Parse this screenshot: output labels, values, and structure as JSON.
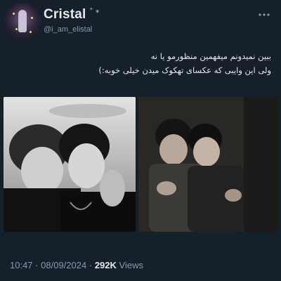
{
  "profile": {
    "display_name": "Cristal",
    "name_decoration": "⁺ ⁎",
    "handle": "@i_am_elistal",
    "avatar_icon": "avatar-photo"
  },
  "header": {
    "more_icon": "more-options-icon"
  },
  "tweet": {
    "lines": [
      "ببین نمیدونم میفهمین منظورمو یا نه",
      "ولی این وایبی که عکسای تهکوک میدن خیلی خوبه:)"
    ]
  },
  "media": {
    "photos": [
      {
        "icon": "photo-black-and-white-selfie"
      },
      {
        "icon": "photo-two-people-posing"
      }
    ]
  },
  "meta": {
    "time": "10:47",
    "date": "08/09/2024",
    "separator": "·",
    "views_count": "292K",
    "views_label": "Views"
  },
  "colors": {
    "background": "#15202b",
    "text_primary": "#e7e9ea",
    "text_secondary": "#8b98a5"
  }
}
